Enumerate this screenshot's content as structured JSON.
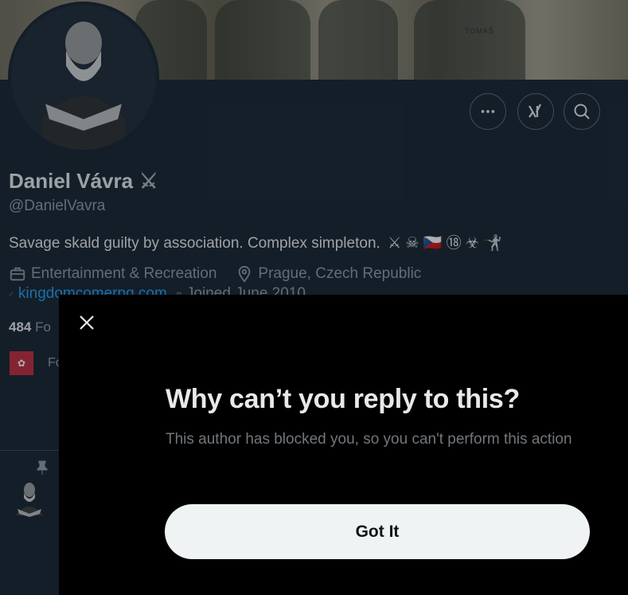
{
  "profile": {
    "name": "Daniel Vávra",
    "name_badge": "⚔",
    "handle": "@DanielVavra",
    "bio": "Savage skald guilty by association. Complex simpleton.",
    "bio_emojis": "⚔ ☠ 🇨🇿 ⑱ ☣ 🤺",
    "category": "Entertainment & Recreation",
    "location": "Prague, Czech Republic",
    "website": "kingdomcomerpg.com",
    "joined": "Joined June 2010",
    "following_count": "484",
    "following_label": "Fo",
    "followed_by_label": "Fo",
    "banner_text": "TOMÁŠ"
  },
  "actions": {
    "more_icon": "more-icon",
    "grok_icon": "grok-icon",
    "search_icon": "search-icon"
  },
  "modal": {
    "title": "Why can’t you reply to this?",
    "body": "This author has blocked you, so you can't perform this action",
    "button_label": "Got It"
  },
  "colors": {
    "background": "#15202b",
    "modal_bg": "#000000",
    "accent": "#1d9bf0",
    "button_bg": "#eff3f4"
  }
}
